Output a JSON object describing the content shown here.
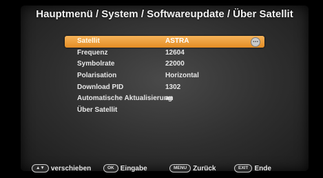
{
  "header": {
    "title": "Hauptmenü / System / Softwareupdate / Über Satellit"
  },
  "menu": {
    "items": [
      {
        "label": "Satellit",
        "value": "ASTRA"
      },
      {
        "label": "Frequenz",
        "value": "12604"
      },
      {
        "label": "Symbolrate",
        "value": "22000"
      },
      {
        "label": "Polarisation",
        "value": "Horizontal"
      },
      {
        "label": "Download PID",
        "value": "1302"
      },
      {
        "label": "Automatische Aktualisierung",
        "value": "an"
      },
      {
        "label": "Über Satellit",
        "value": ""
      }
    ],
    "selected_icon": "select-options-icon"
  },
  "footer": {
    "nav_key": "▲▼",
    "nav_label": "verschieben",
    "ok_key": "OK",
    "ok_label": "Eingabe",
    "menu_key": "MENU",
    "menu_label": "Zurück",
    "exit_key": "EXIT",
    "exit_label": "Ende"
  },
  "colors": {
    "highlight": "#e58d24",
    "background": "#2e2e2e",
    "text": "#e8e8e8"
  }
}
